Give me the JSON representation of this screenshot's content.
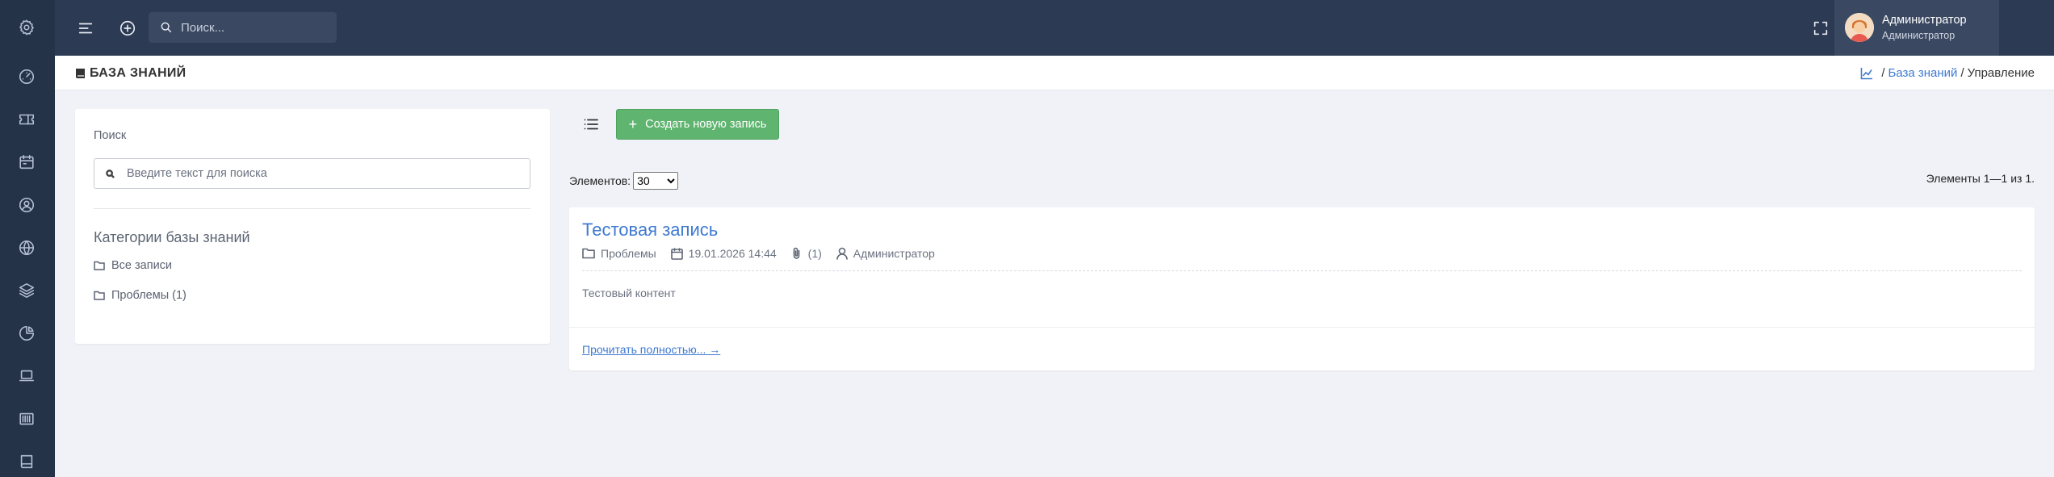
{
  "sidebar": {
    "icons": [
      "settings-icon",
      "dashboard-gauge-icon",
      "ticket-icon",
      "calendar-icon",
      "contacts-icon",
      "globe-icon",
      "layers-icon",
      "pie-chart-icon",
      "laptop-icon",
      "barcode-icon",
      "book-icon"
    ]
  },
  "topbar": {
    "search_placeholder": "Поиск...",
    "user_name": "Администратор",
    "user_role": "Администратор"
  },
  "page": {
    "title": "БАЗА ЗНАНИЙ",
    "breadcrumb": {
      "link": "База знаний",
      "current": "Управление",
      "separator": "/"
    }
  },
  "filters": {
    "search_label": "Поиск",
    "search_placeholder": "Введите текст для поиска",
    "categories_title": "Категории базы знаний",
    "categories": [
      {
        "label": "Все записи"
      },
      {
        "label": "Проблемы (1)"
      }
    ]
  },
  "toolbar": {
    "create_label": "Создать новую запись",
    "create_plus": "+"
  },
  "pagination": {
    "items_label": "Элементов:",
    "page_size": "30",
    "page_size_options": [
      "30"
    ],
    "range_text": "Элементы 1—1 из 1."
  },
  "entries": [
    {
      "title": "Тестовая запись",
      "category": "Проблемы",
      "date": "19.01.2026 14:44",
      "attachments": "(1)",
      "author": "Администратор",
      "content": "Тестовый контент",
      "read_more": "Прочитать полностью... →"
    }
  ],
  "colors": {
    "sidebar_bg": "#253349",
    "topbar_bg": "#2c3a53",
    "accent_link": "#3f7ad1",
    "create_button": "#5fb46f"
  }
}
